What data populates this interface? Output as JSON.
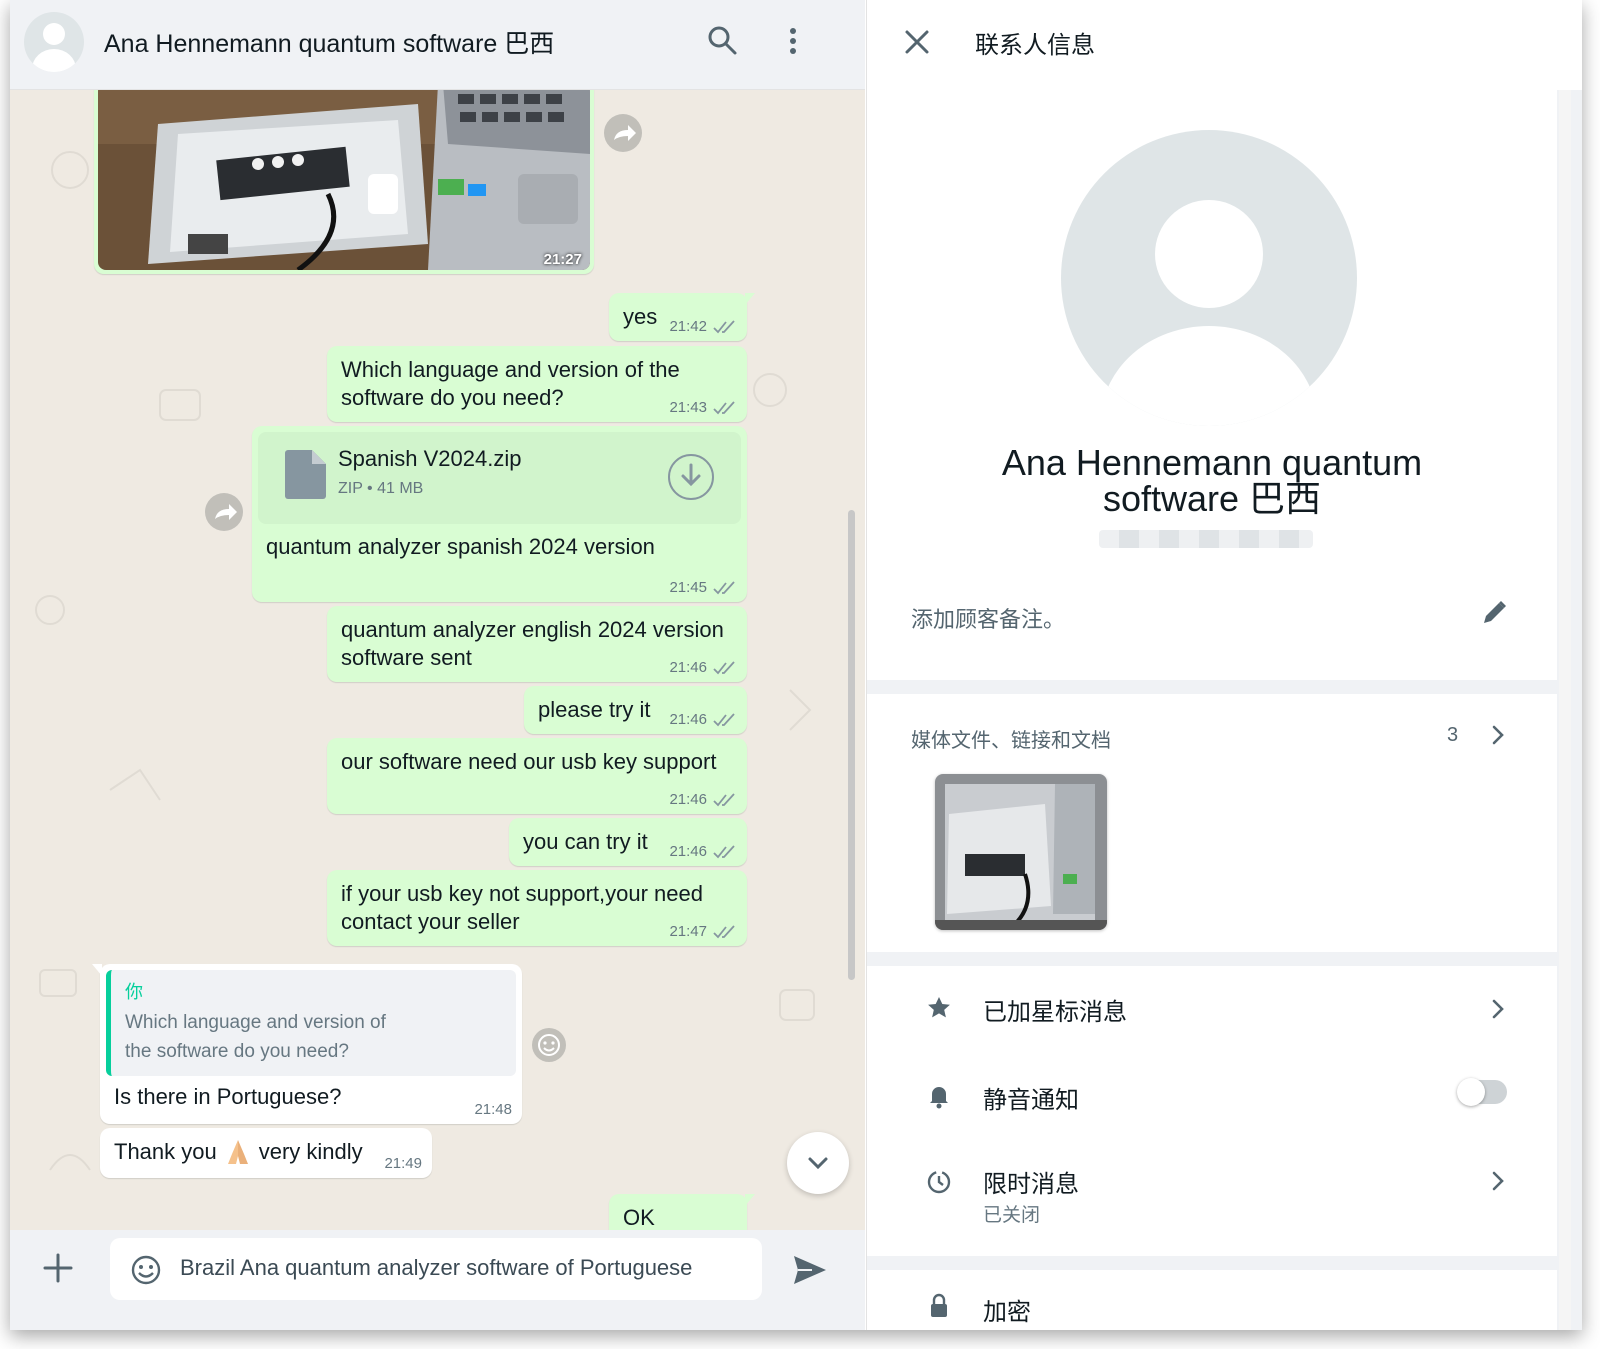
{
  "chat": {
    "title": "Ana Hennemann quantum software 巴西",
    "messages": {
      "image_time": "21:27",
      "yes_text": "yes",
      "yes_time": "21:42",
      "lang_q_line1": "Which language and version of the",
      "lang_q_line2": "software do you need?",
      "lang_q_time": "21:43",
      "file_name": "Spanish V2024.zip",
      "file_meta": "ZIP • 41 MB",
      "file_caption": "quantum analyzer spanish 2024 version",
      "file_time": "21:45",
      "english_line1": "quantum analyzer english 2024 version",
      "english_line2": "software sent",
      "english_time": "21:46",
      "try_text": "please try it",
      "try_time": "21:46",
      "usb_text": "our software need our usb key support",
      "usb_time": "21:46",
      "cantry_text": "you can try it",
      "cantry_time": "21:46",
      "seller_line1": "if your usb key not support,your need",
      "seller_line2": "contact your seller",
      "seller_time": "21:47",
      "quote_author": "你",
      "quote_line1": "Which language and version of",
      "quote_line2": "the software do you need?",
      "portuguese_text": "Is there in Portuguese?",
      "portuguese_time": "21:48",
      "thanks_before": "Thank you",
      "thanks_after": "very kindly",
      "thanks_time": "21:49",
      "partial_text": "OK"
    },
    "composer": {
      "input_value": "Brazil Ana  quantum analyzer software of Portuguese"
    }
  },
  "contact": {
    "header_title": "联系人信息",
    "name_line1": "Ana Hennemann quantum",
    "name_line2": "software 巴西",
    "note_label": "添加顾客备注。",
    "media_label": "媒体文件、链接和文档",
    "media_count": "3",
    "starred_label": "已加星标消息",
    "mute_label": "静音通知",
    "disappearing_label": "限时消息",
    "disappearing_status": "已关闭",
    "partial_label": "加密"
  },
  "colors": {
    "outgoing_bubble": "#d9fdd3",
    "incoming_bubble": "#ffffff",
    "chat_background": "#efeae2",
    "read_ticks": "#8696a0",
    "quote_accent": "#06cf9c"
  },
  "icons": [
    "search-icon",
    "menu-icon",
    "forward-icon",
    "document-icon",
    "download-icon",
    "emoji-icon",
    "chevron-down-icon",
    "plus-icon",
    "sticker-icon",
    "send-icon",
    "close-icon",
    "edit-icon",
    "chevron-right-icon",
    "star-icon",
    "bell-icon",
    "timer-icon",
    "lock-icon"
  ]
}
